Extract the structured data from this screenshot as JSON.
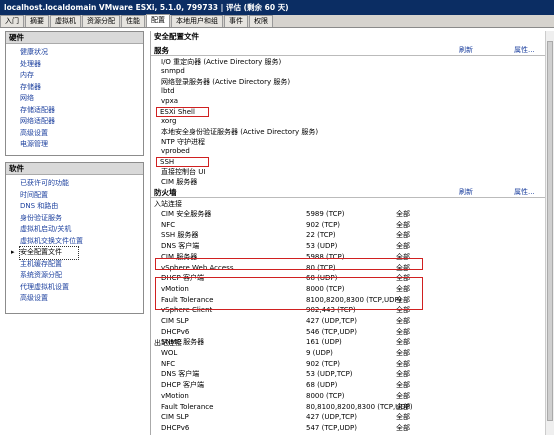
{
  "window": {
    "title": "localhost.localdomain VMware ESXi, 5.1.0, 799733 | 评估 (剩余 60 天)"
  },
  "tabs": [
    "入门",
    "摘要",
    "虚拟机",
    "资源分配",
    "性能",
    "配置",
    "本地用户和组",
    "事件",
    "权限"
  ],
  "active_tab": "配置",
  "hardware": {
    "title": "硬件",
    "items": [
      "健康状况",
      "处理器",
      "内存",
      "存储器",
      "网络",
      "存储适配器",
      "网络适配器",
      "高级设置",
      "电源管理"
    ]
  },
  "software": {
    "title": "软件",
    "items": [
      "已获许可的功能",
      "时间配置",
      "DNS 和路由",
      "身份验证服务",
      "虚拟机启动/关机",
      "虚拟机交换文件位置",
      "安全配置文件",
      "主机缓存配置",
      "系统资源分配",
      "代理虚拟机设置",
      "高级设置"
    ],
    "selected": "安全配置文件"
  },
  "main": {
    "title": "安全配置文件",
    "services_title": "服务",
    "refresh": "刷新",
    "properties": "属性...",
    "services": [
      "I/O 重定向器 (Active Directory 服务)",
      "snmpd",
      "网络登录服务器 (Active Directory 服务)",
      "lbtd",
      "vpxa",
      "ESXi Shell",
      "xorg",
      "本地安全身份验证服务器 (Active Directory 服务)",
      "NTP 守护进程",
      "vprobed",
      "SSH",
      "直接控制台 UI",
      "CIM 服务器"
    ],
    "firewall_title": "防火墙",
    "inbound_title": "入站连接",
    "inbound": [
      [
        "CIM 安全服务器",
        "5989 (TCP)",
        "全部"
      ],
      [
        "NFC",
        "902 (TCP)",
        "全部"
      ],
      [
        "SSH 服务器",
        "22 (TCP)",
        "全部"
      ],
      [
        "DNS 客户端",
        "53 (UDP)",
        "全部"
      ],
      [
        "CIM 服务器",
        "5988 (TCP)",
        "全部"
      ],
      [
        "vSphere Web Access",
        "80 (TCP)",
        "全部"
      ],
      [
        "DHCP 客户端",
        "68 (UDP)",
        "全部"
      ],
      [
        "vMotion",
        "8000 (TCP)",
        "全部"
      ],
      [
        "Fault Tolerance",
        "8100,8200,8300 (TCP,UDP)",
        "全部"
      ],
      [
        "vSphere Client",
        "902,443 (TCP)",
        "全部"
      ],
      [
        "CIM SLP",
        "427 (UDP,TCP)",
        "全部"
      ],
      [
        "DHCPv6",
        "546 (TCP,UDP)",
        "全部"
      ],
      [
        "SNMP 服务器",
        "161 (UDP)",
        "全部"
      ]
    ],
    "outbound_title": "出站连接",
    "outbound": [
      [
        "WOL",
        "9 (UDP)",
        "全部"
      ],
      [
        "NFC",
        "902 (TCP)",
        "全部"
      ],
      [
        "DNS 客户端",
        "53 (UDP,TCP)",
        "全部"
      ],
      [
        "DHCP 客户端",
        "68 (UDP)",
        "全部"
      ],
      [
        "vMotion",
        "8000 (TCP)",
        "全部"
      ],
      [
        "Fault Tolerance",
        "80,8100,8200,8300 (TCP,UDP)",
        "全部"
      ],
      [
        "CIM SLP",
        "427 (UDP,TCP)",
        "全部"
      ],
      [
        "DHCPv6",
        "547 (TCP,UDP)",
        "全部"
      ]
    ]
  }
}
